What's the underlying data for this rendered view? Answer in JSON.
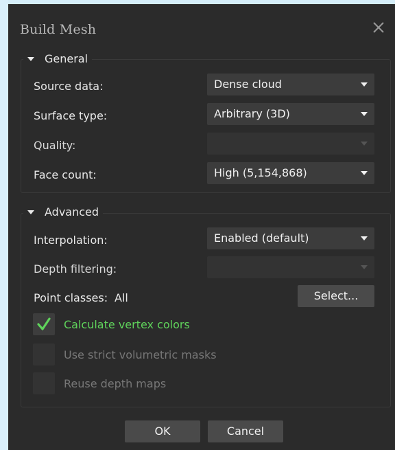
{
  "dialog": {
    "title": "Build Mesh",
    "close_icon": "close-icon"
  },
  "general": {
    "header": "General",
    "source_data": {
      "label": "Source data:",
      "value": "Dense cloud"
    },
    "surface_type": {
      "label": "Surface type:",
      "value": "Arbitrary (3D)"
    },
    "quality": {
      "label": "Quality:",
      "value": ""
    },
    "face_count": {
      "label": "Face count:",
      "value": "High (5,154,868)"
    }
  },
  "advanced": {
    "header": "Advanced",
    "interpolation": {
      "label": "Interpolation:",
      "value": "Enabled (default)"
    },
    "depth_filtering": {
      "label": "Depth filtering:",
      "value": ""
    },
    "point_classes": {
      "label": "Point classes:",
      "value": "All",
      "button": "Select..."
    },
    "calc_vertex_colors": {
      "label": "Calculate vertex colors",
      "checked": true
    },
    "strict_volumetric": {
      "label": "Use strict volumetric masks",
      "checked": false
    },
    "reuse_depth_maps": {
      "label": "Reuse depth maps",
      "checked": false
    }
  },
  "footer": {
    "ok": "OK",
    "cancel": "Cancel"
  },
  "colors": {
    "dialog_bg": "#2b2b2b",
    "accent_green": "#5fd35b",
    "desktop_bg": "#cfe9f7"
  }
}
